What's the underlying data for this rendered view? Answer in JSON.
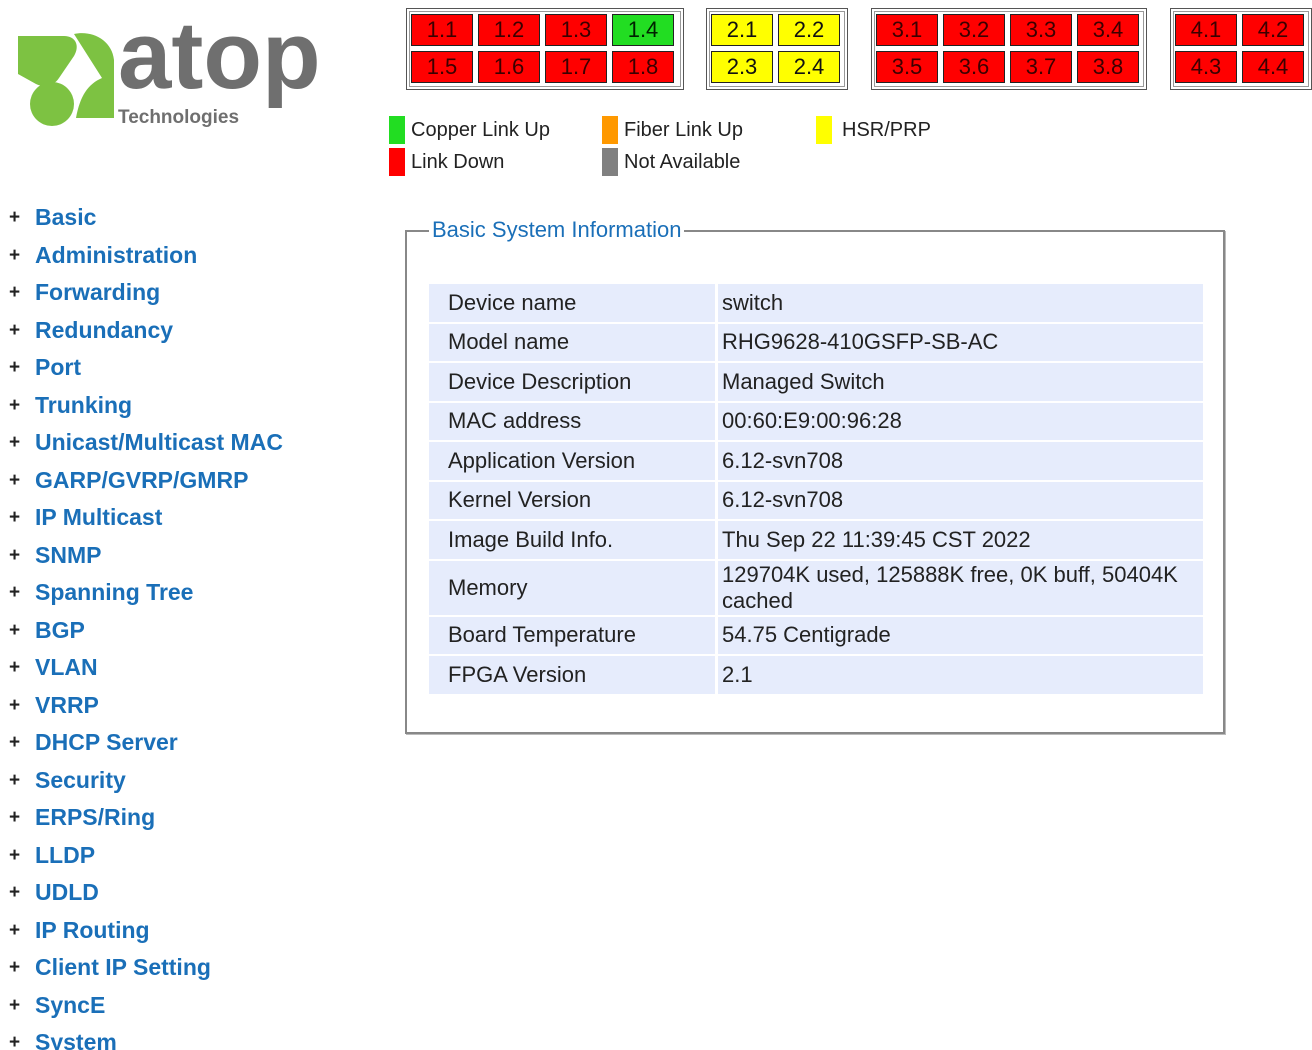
{
  "logo": {
    "brand": "atop",
    "subtitle": "Technologies",
    "colors": {
      "green": "#7dc242",
      "gray": "#6f6f6f"
    }
  },
  "colors": {
    "link_down": "#ff0000",
    "copper_link_up": "#22dd22",
    "fiber_link_up": "#ff9900",
    "hsr_prp": "#ffff00",
    "not_available": "#808080",
    "menu_link": "#1a6fb8",
    "table_row": "#e6ecfc"
  },
  "port_groups": [
    {
      "ports": [
        {
          "label": "1.1",
          "status": "down"
        },
        {
          "label": "1.2",
          "status": "down"
        },
        {
          "label": "1.3",
          "status": "down"
        },
        {
          "label": "1.4",
          "status": "copper"
        },
        {
          "label": "1.5",
          "status": "down"
        },
        {
          "label": "1.6",
          "status": "down"
        },
        {
          "label": "1.7",
          "status": "down"
        },
        {
          "label": "1.8",
          "status": "down"
        }
      ]
    },
    {
      "ports": [
        {
          "label": "2.1",
          "status": "hsr"
        },
        {
          "label": "2.2",
          "status": "hsr"
        },
        {
          "label": "2.3",
          "status": "hsr"
        },
        {
          "label": "2.4",
          "status": "hsr"
        }
      ]
    },
    {
      "ports": [
        {
          "label": "3.1",
          "status": "down"
        },
        {
          "label": "3.2",
          "status": "down"
        },
        {
          "label": "3.3",
          "status": "down"
        },
        {
          "label": "3.4",
          "status": "down"
        },
        {
          "label": "3.5",
          "status": "down"
        },
        {
          "label": "3.6",
          "status": "down"
        },
        {
          "label": "3.7",
          "status": "down"
        },
        {
          "label": "3.8",
          "status": "down"
        }
      ]
    },
    {
      "ports": [
        {
          "label": "4.1",
          "status": "down"
        },
        {
          "label": "4.2",
          "status": "down"
        },
        {
          "label": "4.3",
          "status": "down"
        },
        {
          "label": "4.4",
          "status": "down"
        }
      ]
    }
  ],
  "legend": {
    "copper_link_up": "Copper Link Up",
    "link_down": "Link Down",
    "fiber_link_up": "Fiber Link Up",
    "not_available": "Not Available",
    "hsr_prp": "HSR/PRP"
  },
  "menu": {
    "expand_symbol": "+",
    "items": [
      "Basic",
      "Administration",
      "Forwarding",
      "Redundancy",
      "Port",
      "Trunking",
      "Unicast/Multicast MAC",
      "GARP/GVRP/GMRP",
      "IP Multicast",
      "SNMP",
      "Spanning Tree",
      "BGP",
      "VLAN",
      "VRRP",
      "DHCP Server",
      "Security",
      "ERPS/Ring",
      "LLDP",
      "UDLD",
      "IP Routing",
      "Client IP Setting",
      "SyncE",
      "System"
    ]
  },
  "info": {
    "title": "Basic System Information",
    "rows": [
      {
        "key": "Device name",
        "value": "switch"
      },
      {
        "key": "Model name",
        "value": "RHG9628-410GSFP-SB-AC"
      },
      {
        "key": "Device Description",
        "value": "Managed Switch"
      },
      {
        "key": "MAC address",
        "value": "00:60:E9:00:96:28"
      },
      {
        "key": "Application Version",
        "value": "6.12-svn708"
      },
      {
        "key": "Kernel Version",
        "value": "6.12-svn708"
      },
      {
        "key": "Image Build Info.",
        "value": "Thu Sep 22 11:39:45 CST 2022"
      },
      {
        "key": "Memory",
        "value": "129704K used, 125888K free, 0K buff, 50404K cached"
      },
      {
        "key": "Board Temperature",
        "value": "54.75 Centigrade"
      },
      {
        "key": "FPGA Version",
        "value": "2.1"
      }
    ]
  }
}
